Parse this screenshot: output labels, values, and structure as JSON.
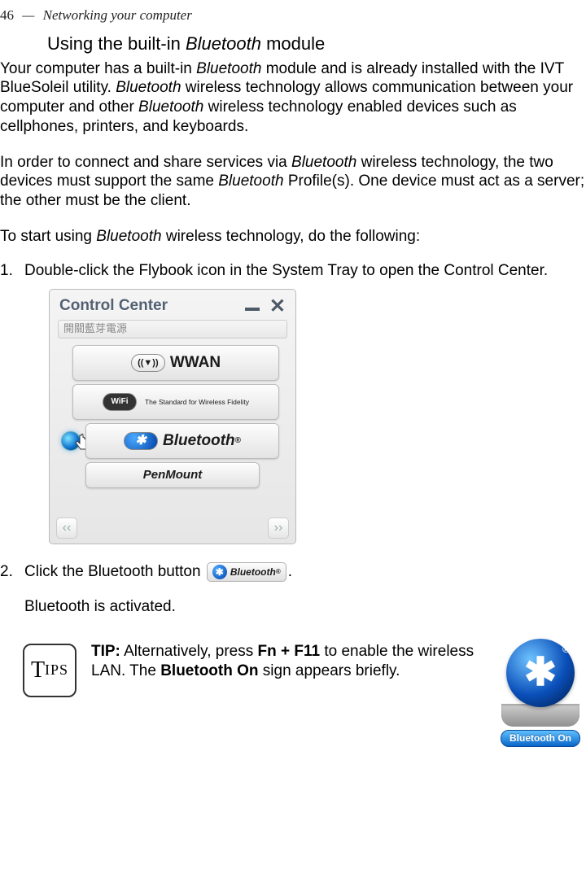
{
  "header": {
    "page_num": "46",
    "dash": "—",
    "chapter": "Networking your computer"
  },
  "section_title": {
    "pre": "Using the built-in ",
    "italic": "Bluetooth",
    "post": " module"
  },
  "p1": {
    "a": "Your computer has a built-in ",
    "b": "Bluetooth",
    "c": " module and is already installed with the IVT BlueSoleil utility. ",
    "d": "Bluetooth",
    "e": " wireless technology allows communication between your computer and other ",
    "f": "Bluetooth",
    "g": " wireless technology enabled devices such as cellphones, printers, and keyboards."
  },
  "p2": {
    "a": "In order to connect and share services via ",
    "b": "Bluetooth",
    "c": " wireless technology, the two devices must support the same ",
    "d": "Bluetooth",
    "e": " Profile(s). One device must act as a server; the other must be the client."
  },
  "p3": {
    "a": "To start using ",
    "b": "Bluetooth",
    "c": " wireless technology, do the following:"
  },
  "steps": {
    "s1": {
      "num": "1.",
      "text": "Double-click the Flybook icon in the System Tray to open the Control Center."
    },
    "s2": {
      "num": "2.",
      "pre": "Click the Bluetooth button ",
      "post": "."
    },
    "s2_sub": "Bluetooth is activated."
  },
  "control_center": {
    "title": "Control Center",
    "subtitle": "開關藍芽電源",
    "wwan": "WWAN",
    "wwan_badge": "((▼))",
    "wifi_badge": "WiFi",
    "wifi_sub": "The Standard for Wireless Fidelity",
    "bt": "Bluetooth",
    "bt_glyph": "✱",
    "pen": "PenMount",
    "arrow_left": "‹‹",
    "arrow_right": "››"
  },
  "inline_bt": {
    "glyph": "✱",
    "label": "Bluetooth"
  },
  "tip": {
    "label_t": "T",
    "label_ips": "IPS",
    "text_a": "TIP:",
    "text_b": " Alternatively, press ",
    "text_c": "Fn + F11",
    "text_d": " to enable the wireless LAN. The ",
    "text_e": "Bluetooth On",
    "text_f": " sign appears briefly."
  },
  "bt_device": {
    "glyph": "✱",
    "label": "Bluetooth On"
  }
}
